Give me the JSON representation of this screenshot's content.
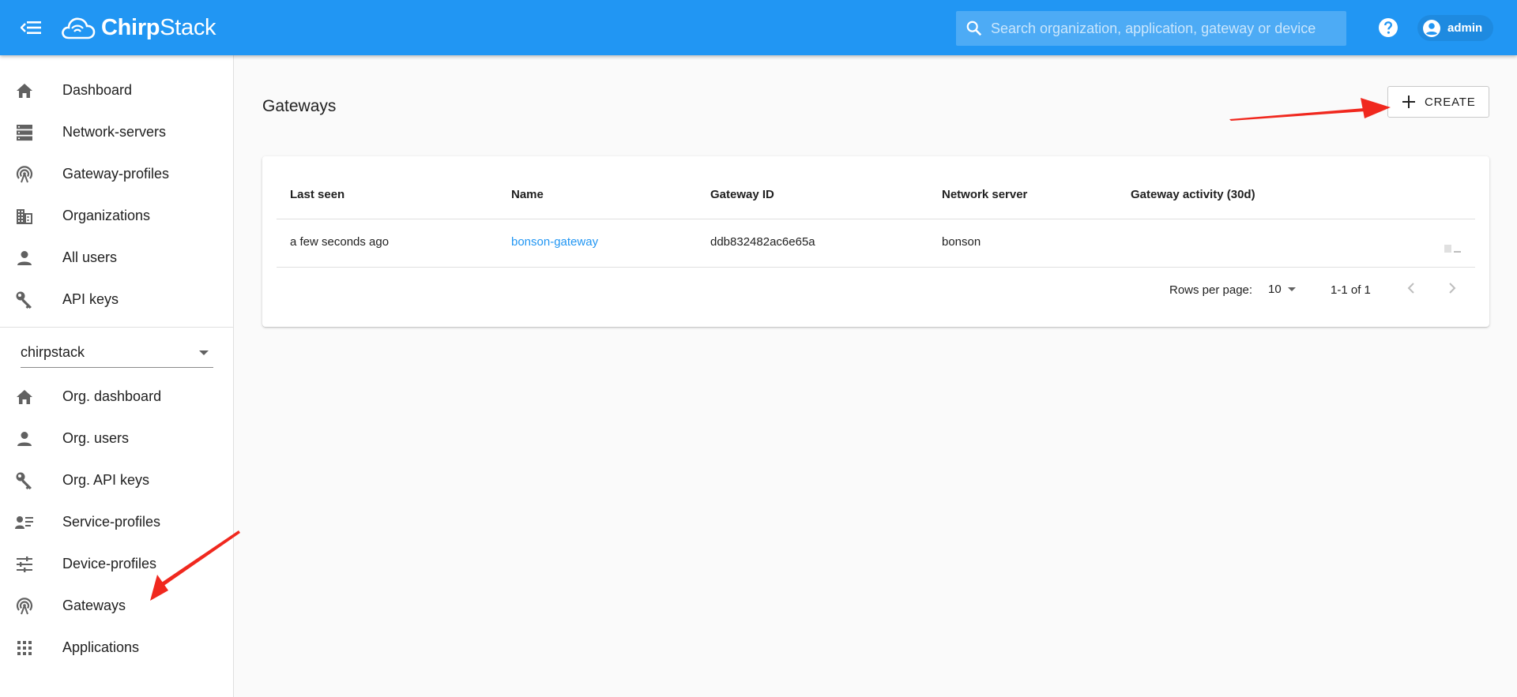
{
  "app": {
    "logo_text_bold": "Chirp",
    "logo_text_light": "Stack"
  },
  "header": {
    "search_placeholder": "Search organization, application, gateway or device",
    "user": "admin"
  },
  "sidebar": {
    "global_items": [
      {
        "label": "Dashboard",
        "icon": "home-icon"
      },
      {
        "label": "Network-servers",
        "icon": "server-icon"
      },
      {
        "label": "Gateway-profiles",
        "icon": "broadcast-icon"
      },
      {
        "label": "Organizations",
        "icon": "building-icon"
      },
      {
        "label": "All users",
        "icon": "person-icon"
      },
      {
        "label": "API keys",
        "icon": "key-icon"
      }
    ],
    "org_select_value": "chirpstack",
    "org_items": [
      {
        "label": "Org. dashboard",
        "icon": "home-icon"
      },
      {
        "label": "Org. users",
        "icon": "person-icon"
      },
      {
        "label": "Org. API keys",
        "icon": "key-icon"
      },
      {
        "label": "Service-profiles",
        "icon": "account-list-icon"
      },
      {
        "label": "Device-profiles",
        "icon": "tune-icon"
      },
      {
        "label": "Gateways",
        "icon": "broadcast-icon"
      },
      {
        "label": "Applications",
        "icon": "apps-grid-icon"
      }
    ]
  },
  "main": {
    "title": "Gateways",
    "create_label": "CREATE",
    "table": {
      "columns": [
        "Last seen",
        "Name",
        "Gateway ID",
        "Network server",
        "Gateway activity (30d)"
      ],
      "rows": [
        {
          "last_seen": "a few seconds ago",
          "name": "bonson-gateway",
          "gateway_id": "ddb832482ac6e65a",
          "network_server": "bonson"
        }
      ]
    },
    "pagination": {
      "rows_per_page_label": "Rows per page:",
      "rows_per_page": "10",
      "range": "1-1 of 1"
    }
  },
  "colors": {
    "primary": "#2196f3",
    "annotation_arrow": "#f0281e"
  }
}
